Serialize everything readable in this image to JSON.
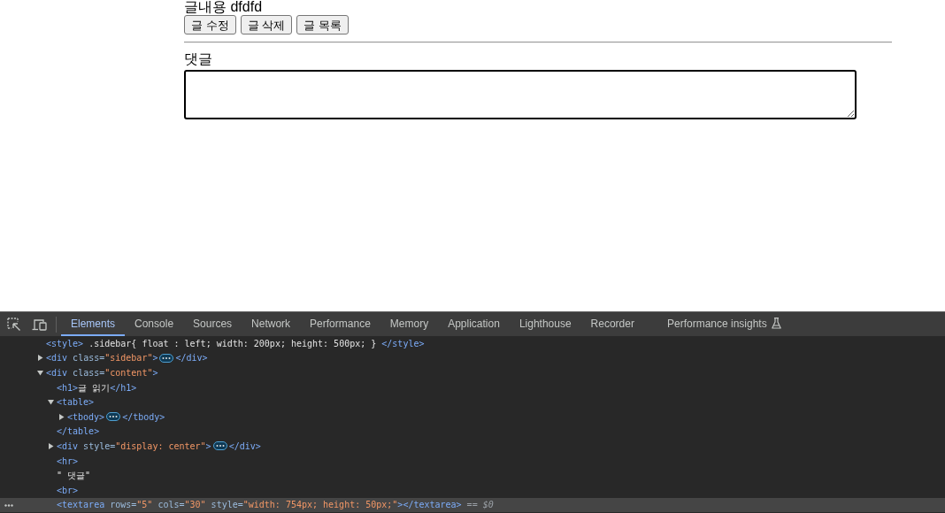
{
  "page": {
    "content_line": "글내용 dfdfd",
    "buttons": [
      "글 수정",
      "글 삭제",
      "글 목록"
    ],
    "comment_label": "댓글"
  },
  "devtools": {
    "tabs": [
      {
        "label": "Elements",
        "selected": true,
        "experimental": false
      },
      {
        "label": "Console",
        "selected": false,
        "experimental": false
      },
      {
        "label": "Sources",
        "selected": false,
        "experimental": false
      },
      {
        "label": "Network",
        "selected": false,
        "experimental": false
      },
      {
        "label": "Performance",
        "selected": false,
        "experimental": false
      },
      {
        "label": "Memory",
        "selected": false,
        "experimental": false
      },
      {
        "label": "Application",
        "selected": false,
        "experimental": false
      },
      {
        "label": "Lighthouse",
        "selected": false,
        "experimental": false
      },
      {
        "label": "Recorder",
        "selected": false,
        "experimental": false
      },
      {
        "label": "Performance insights",
        "selected": false,
        "experimental": true
      }
    ],
    "dom_tree": [
      {
        "kind": "leaf",
        "selected": false,
        "open": [
          {
            "kind": "tag",
            "text": "<style>"
          },
          {
            "kind": "text",
            "text": " .sidebar{ float : left; width: 200px; height: 500px; } "
          },
          {
            "kind": "tag",
            "text": "</style>"
          }
        ]
      },
      {
        "kind": "branch",
        "selected": false,
        "expanded": false,
        "open": [
          {
            "kind": "tag",
            "text": "<div"
          },
          {
            "kind": "attr",
            "text": " class="
          },
          {
            "kind": "value",
            "text": "\"sidebar\""
          },
          {
            "kind": "tag",
            "text": ">"
          }
        ],
        "close": [
          {
            "kind": "tag",
            "text": "</div>"
          }
        ]
      },
      {
        "kind": "branch",
        "selected": false,
        "expanded": true,
        "open": [
          {
            "kind": "tag",
            "text": "<div"
          },
          {
            "kind": "attr",
            "text": " class="
          },
          {
            "kind": "value",
            "text": "\"content\""
          },
          {
            "kind": "tag",
            "text": ">"
          }
        ],
        "children": [
          {
            "kind": "leaf",
            "selected": false,
            "open": [
              {
                "kind": "tag",
                "text": "<h1>"
              },
              {
                "kind": "text",
                "text": "글 읽기"
              },
              {
                "kind": "tag",
                "text": "</h1>"
              }
            ]
          },
          {
            "kind": "branch",
            "selected": false,
            "expanded": true,
            "open": [
              {
                "kind": "tag",
                "text": "<table>"
              }
            ],
            "children": [
              {
                "kind": "branch",
                "selected": false,
                "expanded": false,
                "open": [
                  {
                    "kind": "tag",
                    "text": "<tbody>"
                  }
                ],
                "close": [
                  {
                    "kind": "tag",
                    "text": "</tbody>"
                  }
                ]
              }
            ],
            "close": [
              {
                "kind": "tag",
                "text": "</table>"
              }
            ]
          },
          {
            "kind": "branch",
            "selected": false,
            "expanded": false,
            "open": [
              {
                "kind": "tag",
                "text": "<div"
              },
              {
                "kind": "attr",
                "text": " style="
              },
              {
                "kind": "value",
                "text": "\"display: center\""
              },
              {
                "kind": "tag",
                "text": ">"
              }
            ],
            "close": [
              {
                "kind": "tag",
                "text": "</div>"
              }
            ]
          },
          {
            "kind": "leaf",
            "selected": false,
            "open": [
              {
                "kind": "tag",
                "text": "<hr>"
              }
            ]
          },
          {
            "kind": "leaf",
            "selected": false,
            "open": [
              {
                "kind": "text",
                "text": "\" 댓글\""
              }
            ]
          },
          {
            "kind": "leaf",
            "selected": false,
            "open": [
              {
                "kind": "tag",
                "text": "<br>"
              }
            ]
          },
          {
            "kind": "leaf",
            "selected": true,
            "open": [
              {
                "kind": "tag",
                "text": "<textarea"
              },
              {
                "kind": "attr",
                "text": " rows="
              },
              {
                "kind": "value",
                "text": "\"5\""
              },
              {
                "kind": "attr",
                "text": " cols="
              },
              {
                "kind": "value",
                "text": "\"30\""
              },
              {
                "kind": "attr",
                "text": " style="
              },
              {
                "kind": "value",
                "text": "\"width: 754px; height: 50px;\""
              },
              {
                "kind": "tag",
                "text": "></textarea>"
              }
            ],
            "ref": "== $0"
          }
        ]
      }
    ]
  }
}
